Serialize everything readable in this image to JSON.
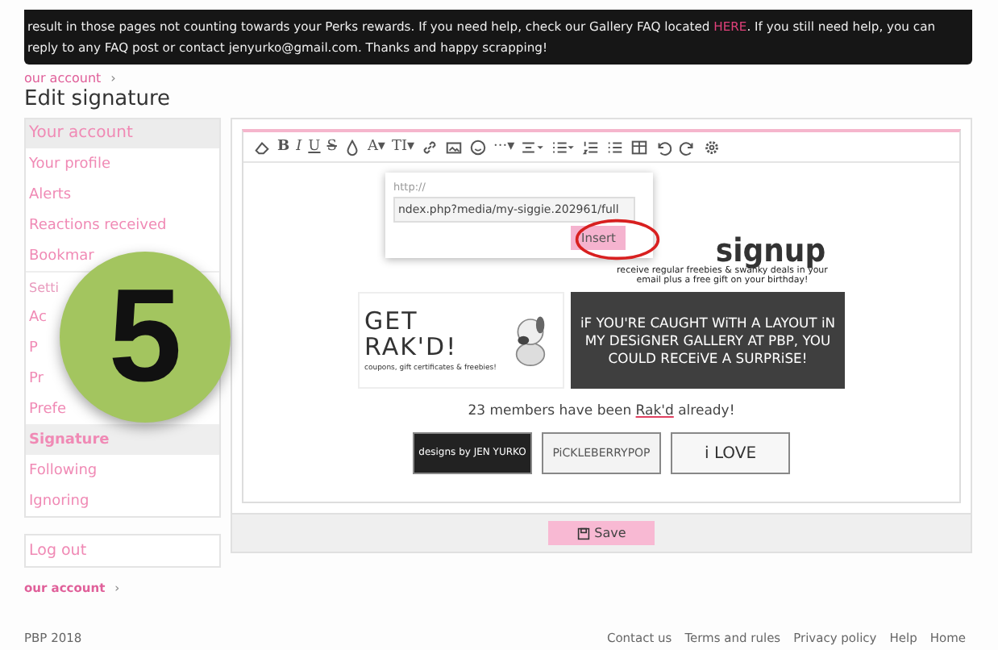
{
  "notice": {
    "before": "result in those pages not counting towards your Perks rewards. If you need help, check our Gallery FAQ located ",
    "link": "HERE",
    "after": ". If you still need help, you can reply to any FAQ post or contact jenyurko@gmail.com. Thanks and happy scrapping!"
  },
  "breadcrumb": "our account",
  "breadcrumb_arrow": "›",
  "title": "Edit signature",
  "sidebar": [
    {
      "kind": "header",
      "label": "Your account"
    },
    {
      "kind": "link",
      "label": "Your profile",
      "selected": false
    },
    {
      "kind": "link",
      "label": "Alerts",
      "selected": false
    },
    {
      "kind": "link",
      "label": "Reactions received",
      "selected": false
    },
    {
      "kind": "link",
      "label": "Bookmar",
      "selected": false
    },
    {
      "kind": "subheader",
      "label": "Setti"
    },
    {
      "kind": "link",
      "label": "Ac",
      "selected": false
    },
    {
      "kind": "link",
      "label": "P",
      "selected": false
    },
    {
      "kind": "link",
      "label": "Pr",
      "selected": false
    },
    {
      "kind": "link",
      "label": "Prefe",
      "selected": false
    },
    {
      "kind": "link",
      "label": "Signature",
      "selected": true
    },
    {
      "kind": "link",
      "label": "Following",
      "selected": false
    },
    {
      "kind": "link",
      "label": "Ignoring",
      "selected": false
    }
  ],
  "logout": "Log out",
  "step_badge": "5",
  "toolbar": [
    {
      "kind": "eraser"
    },
    {
      "kind": "bold",
      "label": "B"
    },
    {
      "kind": "italic",
      "label": "I"
    },
    {
      "kind": "underline",
      "label": "U"
    },
    {
      "kind": "strike",
      "label": "S"
    },
    {
      "kind": "drop"
    },
    {
      "kind": "text",
      "label": "A▾"
    },
    {
      "kind": "text",
      "label": "TI▾"
    },
    {
      "kind": "link"
    },
    {
      "kind": "image"
    },
    {
      "kind": "smile"
    },
    {
      "kind": "text",
      "label": "···▾"
    },
    {
      "kind": "align"
    },
    {
      "kind": "list"
    },
    {
      "kind": "olist"
    },
    {
      "kind": "ulist"
    },
    {
      "kind": "table"
    },
    {
      "kind": "undo"
    },
    {
      "kind": "redo"
    },
    {
      "kind": "gear"
    }
  ],
  "popup": {
    "label": "http://",
    "value": "ndex.php?media/my-siggie.202961/full",
    "button": "Insert"
  },
  "signature": {
    "signup": "signup",
    "signup_sub": "receive regular freebies & swanky deals in your email plus a free gift on your birthday!",
    "rak_title": "GET RAK'D!",
    "rak_sub": "coupons, gift certificates & freebies!",
    "caught": "iF YOU'RE CAUGHT WiTH A LAYOUT iN MY DESiGNER GALLERY AT PBP, YOU COULD RECEiVE A SURPRiSE!",
    "members_before": "23 members have been ",
    "members_link": "Rak'd",
    "members_after": " already!",
    "badges": [
      "designs by JEN YURKO",
      "PiCKLEBERRYPOP",
      "i LOVE"
    ]
  },
  "save_button": "Save",
  "breadcrumb_bottom": "our account",
  "copyright": "PBP 2018",
  "footer_links": [
    "Contact us",
    "Terms and rules",
    "Privacy policy",
    "Help",
    "Home"
  ]
}
